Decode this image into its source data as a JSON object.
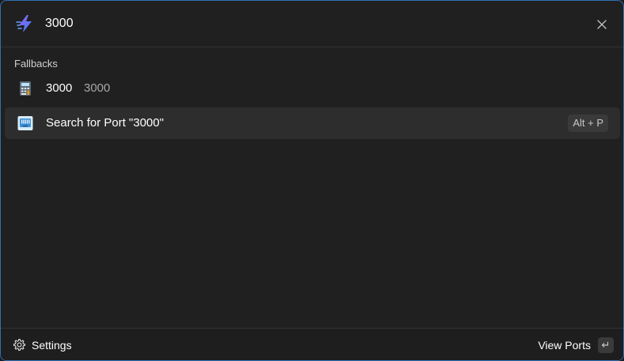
{
  "search": {
    "query": "3000",
    "placeholder": ""
  },
  "section": {
    "title": "Fallbacks"
  },
  "results": [
    {
      "title": "3000",
      "subtitle": "3000",
      "icon": "calculator-icon",
      "selected": false
    },
    {
      "title": "Search for Port \"3000\"",
      "icon": "network-port-icon",
      "shortcut": "Alt + P",
      "selected": true
    }
  ],
  "footer": {
    "settings_label": "Settings",
    "primary_action_label": "View Ports",
    "enter_glyph": "↵"
  },
  "colors": {
    "window_bg": "#202020",
    "selected_bg": "#2d2d2d",
    "border_accent": "#2f6fb3",
    "subtitle_text": "#a8a8a8"
  }
}
